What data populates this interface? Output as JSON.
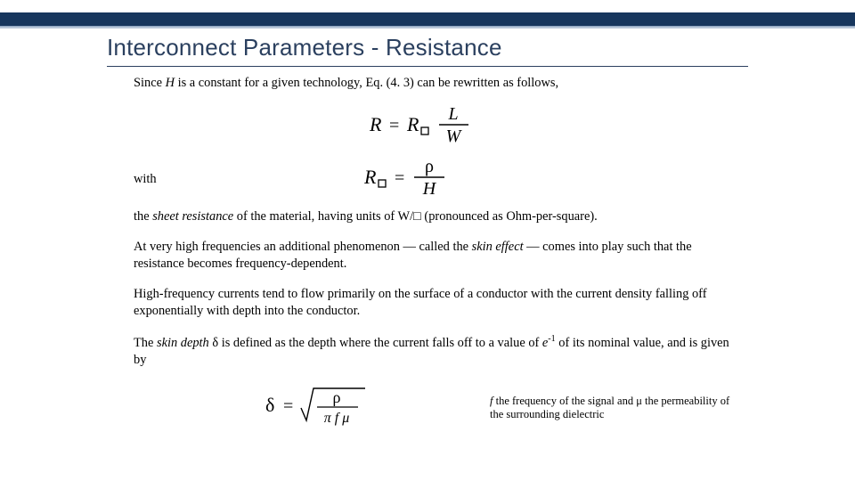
{
  "title": "Interconnect Parameters - Resistance",
  "p1_a": "Since ",
  "p1_H": "H",
  "p1_b": " is a constant for a given technology, Eq. (4. 3) can be rewritten as follows,",
  "with": "with",
  "p2_a": "the ",
  "p2_em": "sheet resistance",
  "p2_b": " of the material, having units of W/□ (pronounced as Ohm-per-square).",
  "p3_a": "At very high frequencies an additional phenomenon — called the ",
  "p3_em": "skin effect",
  "p3_b": " — comes into play such that the resistance becomes frequency-dependent.",
  "p4": "High-frequency currents tend to flow primarily on the surface of a conductor with the current density falling off exponentially with depth into the conductor.",
  "p5_a": "The ",
  "p5_em": "skin depth",
  "p5_delta": " δ",
  "p5_b": " is defined as the depth where the current falls off to a value of ",
  "p5_e": "e",
  "p5_exp": "-1",
  "p5_c": " of its nominal value, and is given by",
  "note_a": "f ",
  "note_b": "the frequency of the signal and μ the permeability of the surrounding dielectric"
}
